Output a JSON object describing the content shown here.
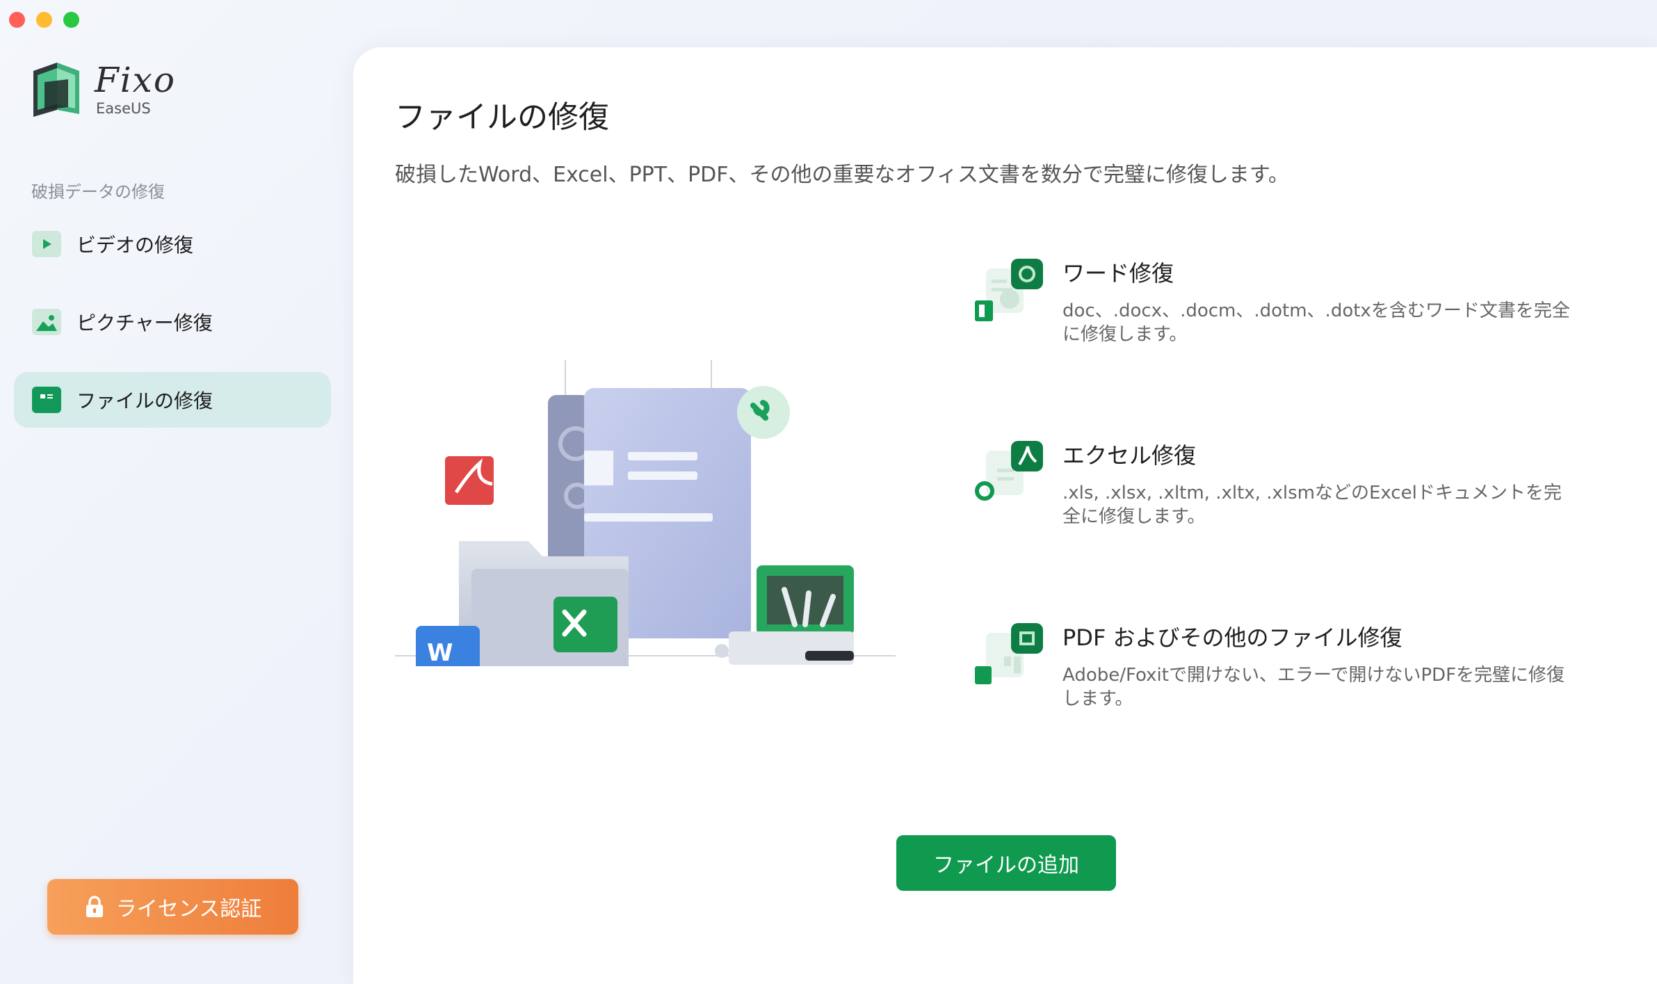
{
  "app": {
    "logo_title": "Fixo",
    "logo_subtitle": "EaseUS"
  },
  "sidebar": {
    "section_label": "破損データの修復",
    "items": [
      {
        "label": "ビデオの修復",
        "icon": "video-play-icon",
        "active": false
      },
      {
        "label": "ピクチャー修復",
        "icon": "picture-icon",
        "active": false
      },
      {
        "label": "ファイルの修復",
        "icon": "document-icon",
        "active": true
      }
    ],
    "license_button": "ライセンス認証"
  },
  "main": {
    "title": "ファイルの修復",
    "description": "破損したWord、Excel、PPT、PDF、その他の重要なオフィス文書を数分で完璧に修復します。",
    "features": [
      {
        "title": "ワード修復",
        "desc": "doc、.docx、.docm、.dotm、.dotxを含むワード文書を完全に修復します。",
        "icon": "word-repair-icon"
      },
      {
        "title": "エクセル修復",
        "desc": ".xls, .xlsx, .xltm, .xltx, .xlsmなどのExcelドキュメントを完全に修復します。",
        "icon": "excel-repair-icon"
      },
      {
        "title": "PDF およびその他のファイル修復",
        "desc": "Adobe/Foxitで開けない、エラーで開けないPDFを完璧に修復します。",
        "icon": "pdf-repair-icon"
      }
    ],
    "add_button": "ファイルの追加"
  },
  "colors": {
    "accent_green": "#0f9a4f",
    "active_nav_bg": "#d6ecea",
    "license_orange": "#ee7e3a"
  }
}
